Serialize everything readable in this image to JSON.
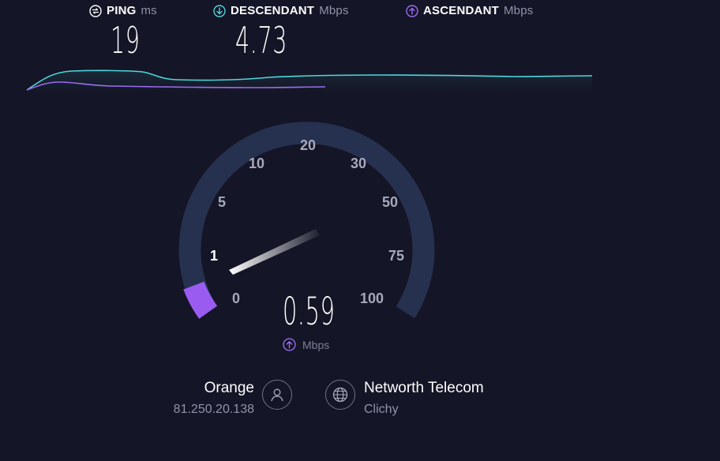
{
  "metrics": {
    "ping": {
      "label": "PING",
      "unit": "ms",
      "value": "19",
      "icon": "ping-icon"
    },
    "download": {
      "label": "DESCENDANT",
      "unit": "Mbps",
      "value": "4.73",
      "icon": "download-arrow-icon"
    },
    "upload": {
      "label": "ASCENDANT",
      "unit": "Mbps",
      "icon": "upload-arrow-icon"
    }
  },
  "gauge": {
    "ticks": [
      "0",
      "1",
      "5",
      "10",
      "20",
      "30",
      "50",
      "75",
      "100"
    ],
    "current_value": "0.59",
    "unit": "Mbps",
    "active_tick": "1"
  },
  "isp": {
    "name": "Orange",
    "ip": "81.250.20.138",
    "icon": "user-icon"
  },
  "server": {
    "name": "Networth Telecom",
    "location": "Clichy",
    "icon": "globe-icon"
  },
  "colors": {
    "background": "#141526",
    "download": "#4fd6d8",
    "upload": "#9b6cf0",
    "gauge_track": "#26304f",
    "gauge_fill": "#9a5cf0"
  }
}
